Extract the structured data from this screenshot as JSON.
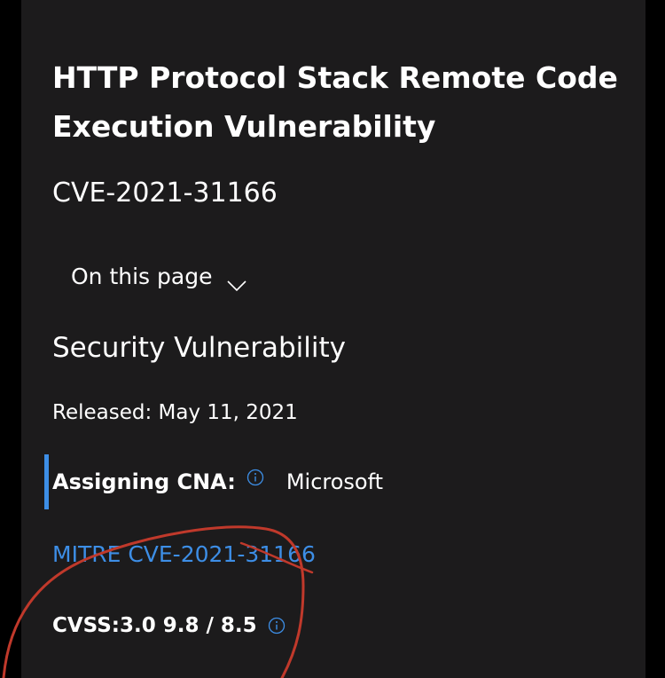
{
  "header": {
    "title": "HTTP Protocol Stack Remote Code Execution Vulnerability",
    "cve_id": "CVE-2021-31166"
  },
  "on_this_page": {
    "label": "On this page"
  },
  "section": {
    "title": "Security Vulnerability",
    "released": "Released: May 11, 2021"
  },
  "assigning_cna": {
    "label": "Assigning CNA:",
    "value": "Microsoft"
  },
  "mitre_link": {
    "label": "MITRE CVE-2021-31166"
  },
  "cvss": {
    "text": "CVSS:3.0 9.8 / 8.5"
  },
  "colors": {
    "background": "#000000",
    "panel": "#1c1b1c",
    "accent": "#3d8ee6",
    "annotation": "#c0392b"
  },
  "icons": [
    "chevron-down-icon",
    "info-icon"
  ]
}
